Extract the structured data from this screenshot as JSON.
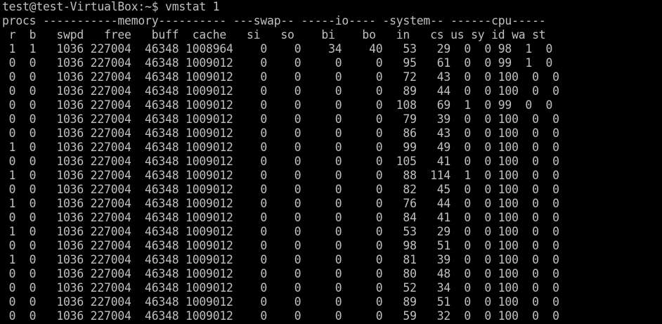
{
  "terminal": {
    "prompt": "test@test-VirtualBox:~$ vmstat 1",
    "header_groups": "procs -----------memory---------- ---swap-- -----io---- -system-- ------cpu-----",
    "header_columns": " r  b   swpd   free   buff  cache   si   so    bi    bo   in   cs us sy id wa st",
    "rows": [
      " 1  1   1036 227004  46348 1008964    0    0    34    40   53   29  0  0 98  1  0",
      " 0  0   1036 227004  46348 1009012    0    0     0     0   95   61  0  0 99  1  0",
      " 0  0   1036 227004  46348 1009012    0    0     0     0   72   43  0  0 100  0  0",
      " 0  0   1036 227004  46348 1009012    0    0     0     0   89   44  0  0 100  0  0",
      " 0  0   1036 227004  46348 1009012    0    0     0     0  108   69  1  0 99  0  0",
      " 0  0   1036 227004  46348 1009012    0    0     0     0   79   39  0  0 100  0  0",
      " 0  0   1036 227004  46348 1009012    0    0     0     0   86   43  0  0 100  0  0",
      " 1  0   1036 227004  46348 1009012    0    0     0     0   99   49  0  0 100  0  0",
      " 0  0   1036 227004  46348 1009012    0    0     0     0  105   41  0  0 100  0  0",
      " 1  0   1036 227004  46348 1009012    0    0     0     0   88  114  1  0 100  0  0",
      " 0  0   1036 227004  46348 1009012    0    0     0     0   82   45  0  0 100  0  0",
      " 1  0   1036 227004  46348 1009012    0    0     0     0   76   44  0  0 100  0  0",
      " 0  0   1036 227004  46348 1009012    0    0     0     0   84   41  0  0 100  0  0",
      " 1  0   1036 227004  46348 1009012    0    0     0     0   53   29  0  0 100  0  0",
      " 0  0   1036 227004  46348 1009012    0    0     0     0   98   51  0  0 100  0  0",
      " 1  0   1036 227004  46348 1009012    0    0     0     0   81   39  0  0 100  0  0",
      " 0  0   1036 227004  46348 1009012    0    0     0     0   80   48  0  0 100  0  0",
      " 0  0   1036 227004  46348 1009012    0    0     0     0   52   34  0  0 100  0  0",
      " 0  0   1036 227004  46348 1009012    0    0     0     0   89   51  0  0 100  0  0",
      " 0  0   1036 227004  46348 1009012    0    0     0     0   59   32  0  0 100  0  0"
    ],
    "colors": {
      "background": "#000000",
      "foreground": "#c0c0c0"
    }
  }
}
